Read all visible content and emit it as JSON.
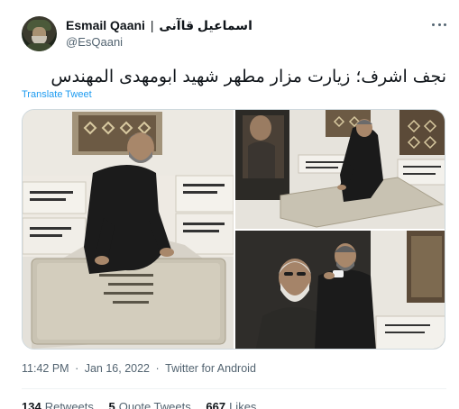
{
  "author": {
    "display_name": "Esmail Qaani",
    "separator": "|",
    "name_persian": "اسماعیل قاآنی",
    "handle": "@EsQaani"
  },
  "tweet": {
    "text": "نجف اشرف؛ زیارت مزار مطهر شهید ابومهدی المهندس",
    "translate_label": "Translate Tweet"
  },
  "meta": {
    "time": "11:42 PM",
    "dot": "·",
    "date": "Jan 16, 2022",
    "source": "Twitter for Android"
  },
  "stats": {
    "retweets_count": "134",
    "retweets_label": "Retweets",
    "quotes_count": "5",
    "quotes_label": "Quote Tweets",
    "likes_count": "667",
    "likes_label": "Likes"
  },
  "colors": {
    "link": "#1d9bf0",
    "secondary_text": "#536471",
    "primary_text": "#0f1419"
  },
  "icons": {
    "more": "more-horizontal-icon"
  }
}
